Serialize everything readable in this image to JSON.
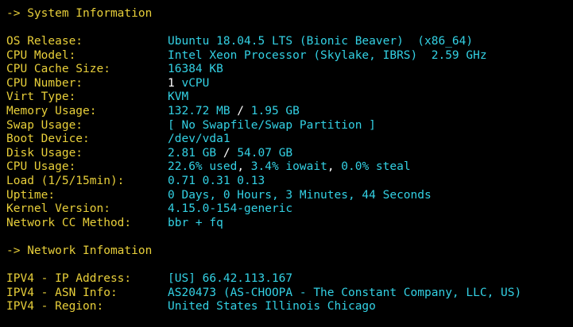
{
  "sections": {
    "system_header": "-> System Information",
    "network_header": "-> Network Infomation"
  },
  "system": {
    "os_release": {
      "label": "OS Release:",
      "value": "Ubuntu 18.04.5 LTS (Bionic Beaver)  (x86_64)"
    },
    "cpu_model": {
      "label": "CPU Model:",
      "value": "Intel Xeon Processor (Skylake, IBRS)  2.59 GHz"
    },
    "cpu_cache": {
      "label": "CPU Cache Size:",
      "value": "16384 KB"
    },
    "cpu_number": {
      "label": "CPU Number:",
      "count": "1",
      "unit": " vCPU"
    },
    "virt_type": {
      "label": "Virt Type:",
      "value": "KVM"
    },
    "memory": {
      "label": "Memory Usage:",
      "used": "132.72 MB",
      "sep": " / ",
      "total": "1.95 GB"
    },
    "swap": {
      "label": "Swap Usage:",
      "value": "[ No Swapfile/Swap Partition ]"
    },
    "boot_device": {
      "label": "Boot Device:",
      "value": "/dev/vda1"
    },
    "disk": {
      "label": "Disk Usage:",
      "used": "2.81 GB",
      "sep": " / ",
      "total": "54.07 GB"
    },
    "cpu_usage": {
      "label": "CPU Usage:",
      "used": "22.6% used",
      "sep1": ", ",
      "iowait": "3.4% iowait",
      "sep2": ", ",
      "steal": "0.0% steal"
    },
    "load": {
      "label": "Load (1/5/15min):",
      "value": "0.71 0.31 0.13"
    },
    "uptime": {
      "label": "Uptime:",
      "value": "0 Days, 0 Hours, 3 Minutes, 44 Seconds"
    },
    "kernel": {
      "label": "Kernel Version:",
      "value": "4.15.0-154-generic"
    },
    "network_cc": {
      "label": "Network CC Method:",
      "value": "bbr + fq"
    }
  },
  "network": {
    "ipv4_address": {
      "label": "IPV4 - IP Address:",
      "value": "[US] 66.42.113.167"
    },
    "ipv4_asn": {
      "label": "IPV4 - ASN Info:",
      "value": "AS20473 (AS-CHOOPA - The Constant Company, LLC, US)"
    },
    "ipv4_region": {
      "label": "IPV4 - Region:",
      "value": "United States Illinois Chicago"
    }
  },
  "colors": {
    "background": "#000000",
    "label": "#e8cf3a",
    "value": "#33d1e4",
    "separator": "#ffffff"
  }
}
